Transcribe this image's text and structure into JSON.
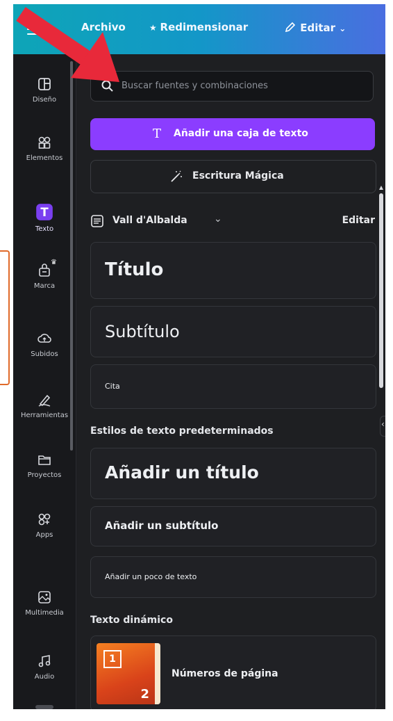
{
  "topbar": {
    "file_label": "Archivo",
    "resize_label": "Redimensionar",
    "edit_label": "Editar"
  },
  "rail": {
    "items": [
      {
        "label": "Diseño",
        "icon": "layout-icon"
      },
      {
        "label": "Elementos",
        "icon": "shapes-icon"
      },
      {
        "label": "Texto",
        "icon": "text-icon"
      },
      {
        "label": "Marca",
        "icon": "brand-icon"
      },
      {
        "label": "Subidos",
        "icon": "upload-cloud-icon"
      },
      {
        "label": "Herramientas",
        "icon": "draw-icon"
      },
      {
        "label": "Proyectos",
        "icon": "folder-icon"
      },
      {
        "label": "Apps",
        "icon": "apps-icon"
      },
      {
        "label": "Multimedia",
        "icon": "media-icon"
      },
      {
        "label": "Audio",
        "icon": "audio-icon"
      }
    ]
  },
  "panel": {
    "search_placeholder": "Buscar fuentes y combinaciones",
    "add_text_box": "Añadir una caja de texto",
    "magic_write": "Escritura Mágica",
    "brand_kit_name": "Vall d'Albalda",
    "brand_kit_edit": "Editar",
    "brand_title": "Título",
    "brand_subtitle": "Subtítulo",
    "brand_quote": "Cita",
    "default_styles_heading": "Estilos de texto predeterminados",
    "add_heading": "Añadir un título",
    "add_subheading": "Añadir un subtítulo",
    "add_body": "Añadir un poco de texto",
    "dynamic_text_heading": "Texto dinámico",
    "page_numbers_label": "Números de página",
    "page_numbers_thumb_one": "1",
    "page_numbers_thumb_two": "2"
  },
  "colors": {
    "accent_purple": "#8b3dff",
    "annotation_red": "#e8293a"
  }
}
